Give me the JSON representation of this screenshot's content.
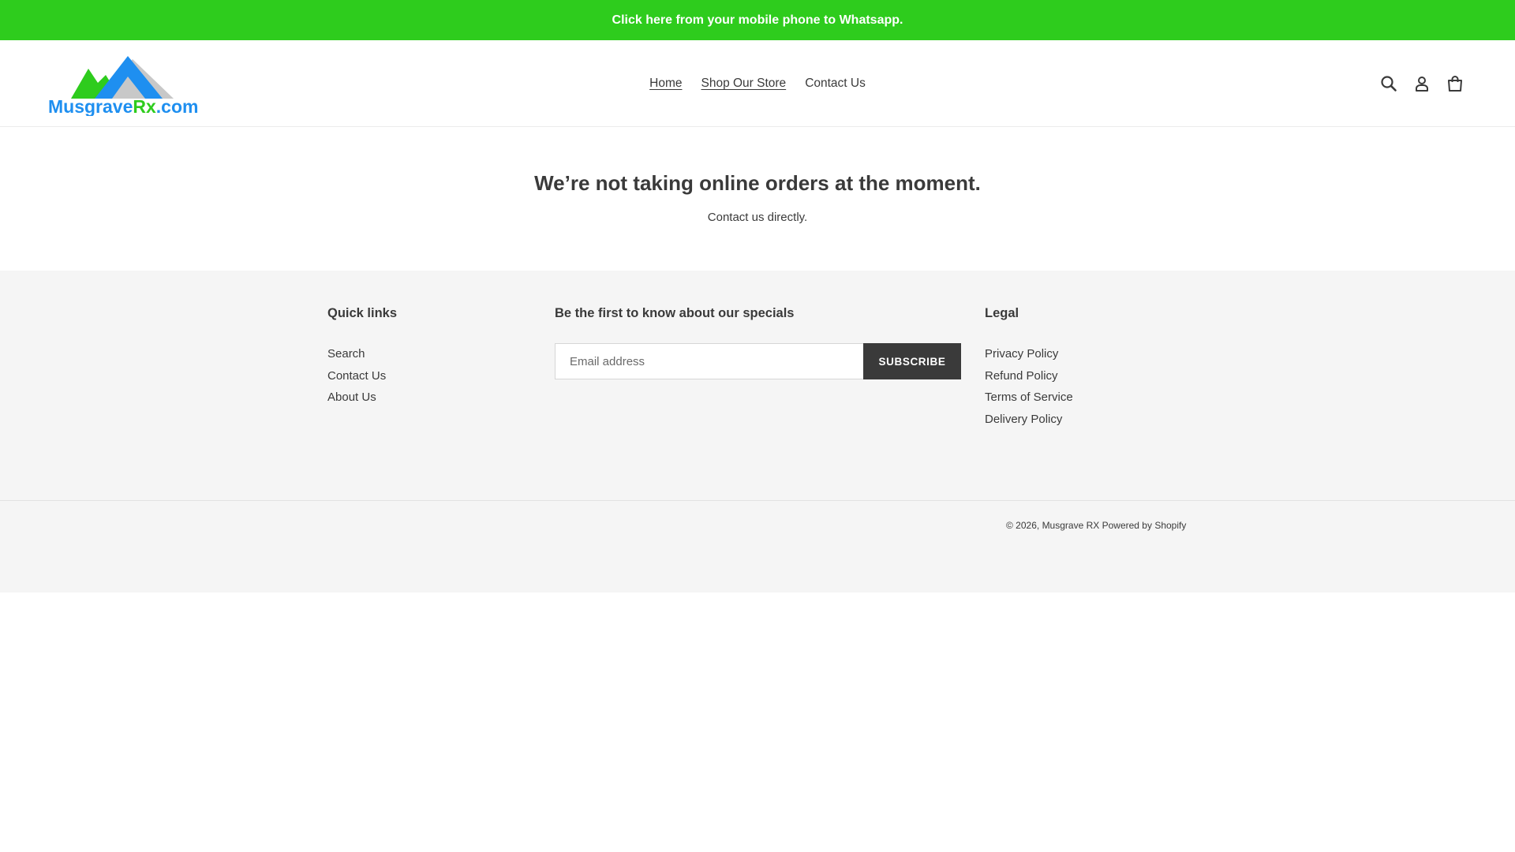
{
  "announcement": {
    "text": "Click here from your mobile phone to Whatsapp.",
    "bg_color": "#2ecc1d"
  },
  "header": {
    "logo": {
      "text_part1": "Musgrave",
      "text_part2": "Rx",
      "text_part3": ".com",
      "colors": {
        "green": "#2ecc1d",
        "blue": "#1e8ff0",
        "gray": "#c8c8c8"
      }
    },
    "nav": [
      {
        "label": "Home"
      },
      {
        "label": "Shop Our Store"
      },
      {
        "label": "Contact Us"
      }
    ],
    "icons": [
      "search-icon",
      "account-icon",
      "cart-icon"
    ]
  },
  "main": {
    "title": "We’re not taking online orders at the moment.",
    "subtitle": "Contact us directly."
  },
  "footer": {
    "quick_links": {
      "heading": "Quick links",
      "items": [
        "Search",
        "Contact Us",
        "About Us"
      ]
    },
    "newsletter": {
      "heading": "Be the first to know about our specials",
      "placeholder": "Email address",
      "button_label": "SUBSCRIBE"
    },
    "legal": {
      "heading": "Legal",
      "items": [
        "Privacy Policy",
        "Refund Policy",
        "Terms of Service",
        "Delivery Policy"
      ]
    },
    "copyright": {
      "prefix": "© 2026,",
      "store_name": "Musgrave RX",
      "powered_by": "Powered by Shopify"
    }
  }
}
